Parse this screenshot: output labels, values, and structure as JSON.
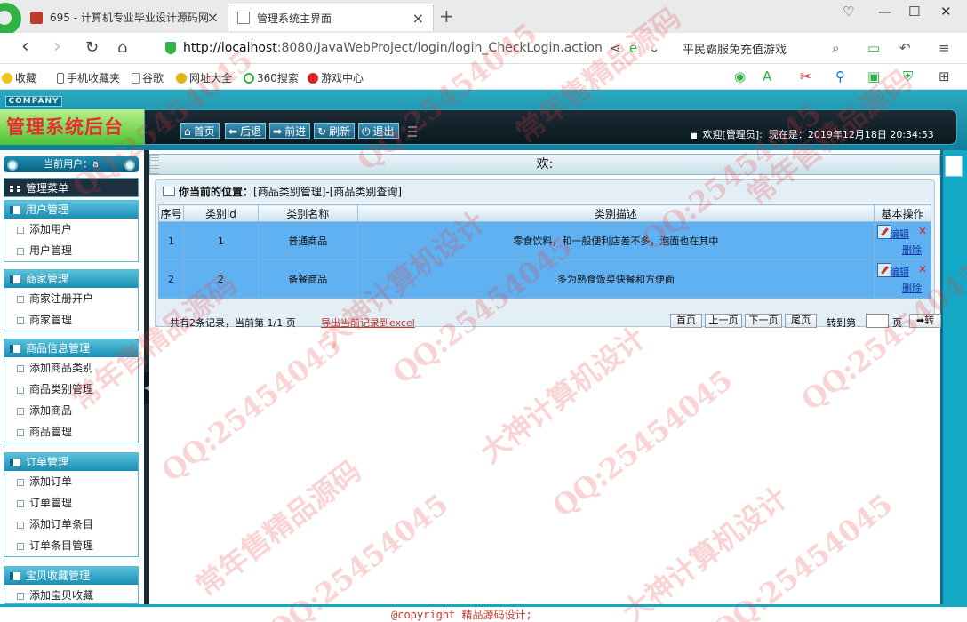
{
  "browser": {
    "tab1_title": "695 - 计算机专业毕业设计源码网",
    "tab2_title": "管理系统主界面",
    "url_host": "http://localhost",
    "url_rest": ":8080/JavaWebProject/login/login_CheckLogin.action",
    "search_text": "平民霸服免充值游戏",
    "favorites": [
      "收藏",
      "手机收藏夹",
      "谷歌",
      "网址大全",
      "360搜索",
      "游戏中心"
    ]
  },
  "header": {
    "company": "COMPANY",
    "system_title": "管理系统后台",
    "toolbar": [
      {
        "glyph": "⌂",
        "label": "首页"
      },
      {
        "glyph": "⬅",
        "label": "后退"
      },
      {
        "glyph": "➡",
        "label": "前进"
      },
      {
        "glyph": "↻",
        "label": "刷新"
      },
      {
        "glyph": "⏻",
        "label": "退出"
      }
    ],
    "welcome": "欢迎[管理员]:",
    "time_label": "现在是：2019年12月18日 20:34:53"
  },
  "sidebar": {
    "current_user": "当前用户：a",
    "manage_menu": "管理菜单",
    "groups": [
      {
        "title": "用户管理",
        "items": [
          "添加用户",
          "用户管理"
        ]
      },
      {
        "title": "商家管理",
        "items": [
          "商家注册开户",
          "商家管理"
        ]
      },
      {
        "title": "商品信息管理",
        "items": [
          "添加商品类别",
          "商品类别管理",
          "添加商品",
          "商品管理"
        ]
      },
      {
        "title": "订单管理",
        "items": [
          "添加订单",
          "订单管理",
          "添加订单条目",
          "订单条目管理"
        ]
      },
      {
        "title": "宝贝收藏管理",
        "items": [
          "添加宝贝收藏"
        ]
      }
    ]
  },
  "main": {
    "top_text": "欢:",
    "breadcrumb_label": "你当前的位置：",
    "breadcrumb_path": "[商品类别管理]-[商品类别查询]",
    "columns": [
      "序号",
      "类别id",
      "类别名称",
      "类别描述",
      "基本操作"
    ],
    "rows": [
      {
        "index": "1",
        "id": "1",
        "name": "普通商品",
        "desc": "零食饮料，和一般便利店差不多，泡面也在其中"
      },
      {
        "index": "2",
        "id": "2",
        "name": "备餐商品",
        "desc": "多为熟食饭菜快餐和方便面"
      }
    ],
    "edit_label": "编辑",
    "delete_label": "删除",
    "pager_info": "共有2条记录，当前第 1/1 页",
    "export_label": "导出当前记录到excel",
    "pager_buttons": [
      "首页",
      "上一页",
      "下一页",
      "尾页"
    ],
    "goto_label": "转到第",
    "page_unit": "页",
    "go_button": "➡转"
  },
  "footer": {
    "copyright": "@copyright 精品源码设计;"
  },
  "watermark": [
    "QQ:25454045",
    "常年售精品源码",
    "大神计算机设计"
  ],
  "colors": {
    "header_teal": "#1b8eb2",
    "title_green": "#4cc334",
    "title_red": "#e92b2b",
    "row_blue": "#5fb1f2",
    "link_blue": "#1438a5"
  }
}
